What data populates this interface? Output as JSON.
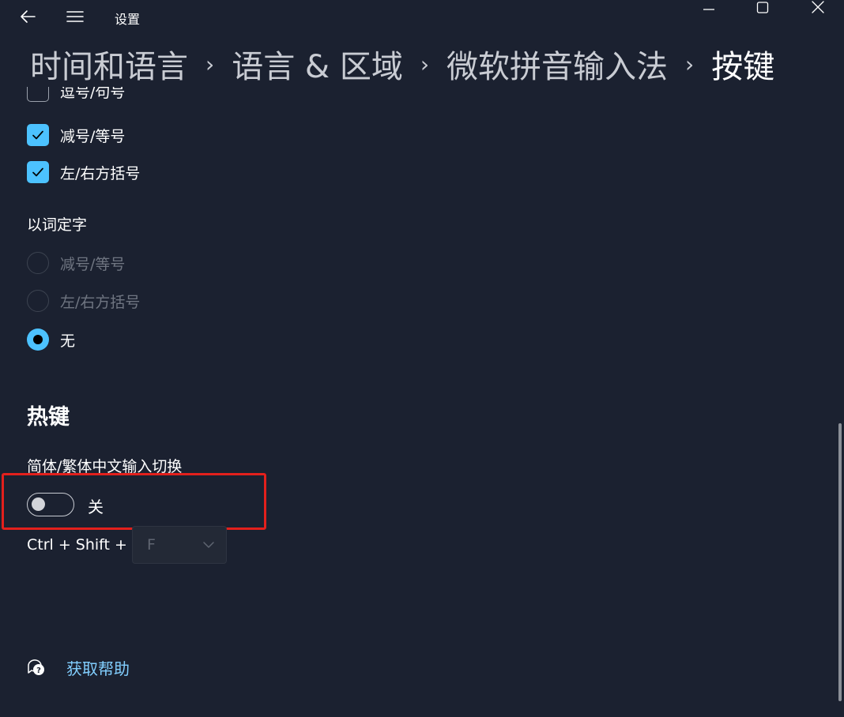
{
  "window": {
    "title": "设置",
    "controls": {
      "minimize": "minimize",
      "maximize": "maximize",
      "close": "close"
    }
  },
  "breadcrumb": {
    "items": [
      "时间和语言",
      "语言 & 区域",
      "微软拼音输入法",
      "按键"
    ],
    "separator": "›"
  },
  "checkbox_options": [
    {
      "label": "逗号/句号",
      "checked": false
    },
    {
      "label": "减号/等号",
      "checked": true
    },
    {
      "label": "左/右方括号",
      "checked": true
    }
  ],
  "word_to_char": {
    "label": "以词定字",
    "options": [
      {
        "label": "减号/等号",
        "selected": false,
        "disabled": true
      },
      {
        "label": "左/右方括号",
        "selected": false,
        "disabled": true
      },
      {
        "label": "无",
        "selected": true,
        "disabled": false
      }
    ]
  },
  "hotkeys": {
    "heading": "热键",
    "switch_label": "简体/繁体中文输入切换",
    "toggle_state": "关",
    "toggle_on": false,
    "shortcut_prefix": "Ctrl + Shift +",
    "shortcut_key": "F"
  },
  "help": {
    "link_text": "获取帮助",
    "icon": "help-chat-icon"
  },
  "colors": {
    "background": "#1b2130",
    "accent": "#4cc2ff",
    "link": "#82cfff",
    "highlight": "#e3201c",
    "disabled_text": "#6f7581"
  }
}
